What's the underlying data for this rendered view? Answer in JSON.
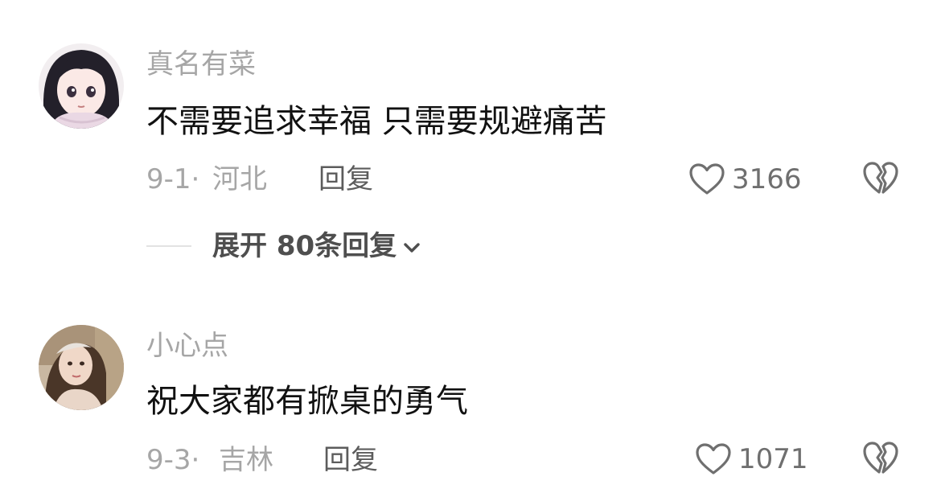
{
  "comments": [
    {
      "username": "真名有菜",
      "content": "不需要追求幸福 只需要规避痛苦",
      "date": "9-1·",
      "location": "河北",
      "reply_label": "回复",
      "like_count": "3166",
      "expand_replies_label": "展开 80条回复"
    },
    {
      "username": "小心点",
      "content": "祝大家都有掀桌的勇气",
      "date": "9-3·",
      "location": "吉林",
      "reply_label": "回复",
      "like_count": "1071"
    }
  ],
  "icons": {
    "like": "heart-outline-icon",
    "dislike": "broken-heart-icon",
    "expand": "chevron-down-icon"
  },
  "colors": {
    "text_primary": "#111111",
    "text_secondary": "#a6a6a6",
    "reply": "#5c5c5c",
    "icon": "#6f6f6f"
  }
}
